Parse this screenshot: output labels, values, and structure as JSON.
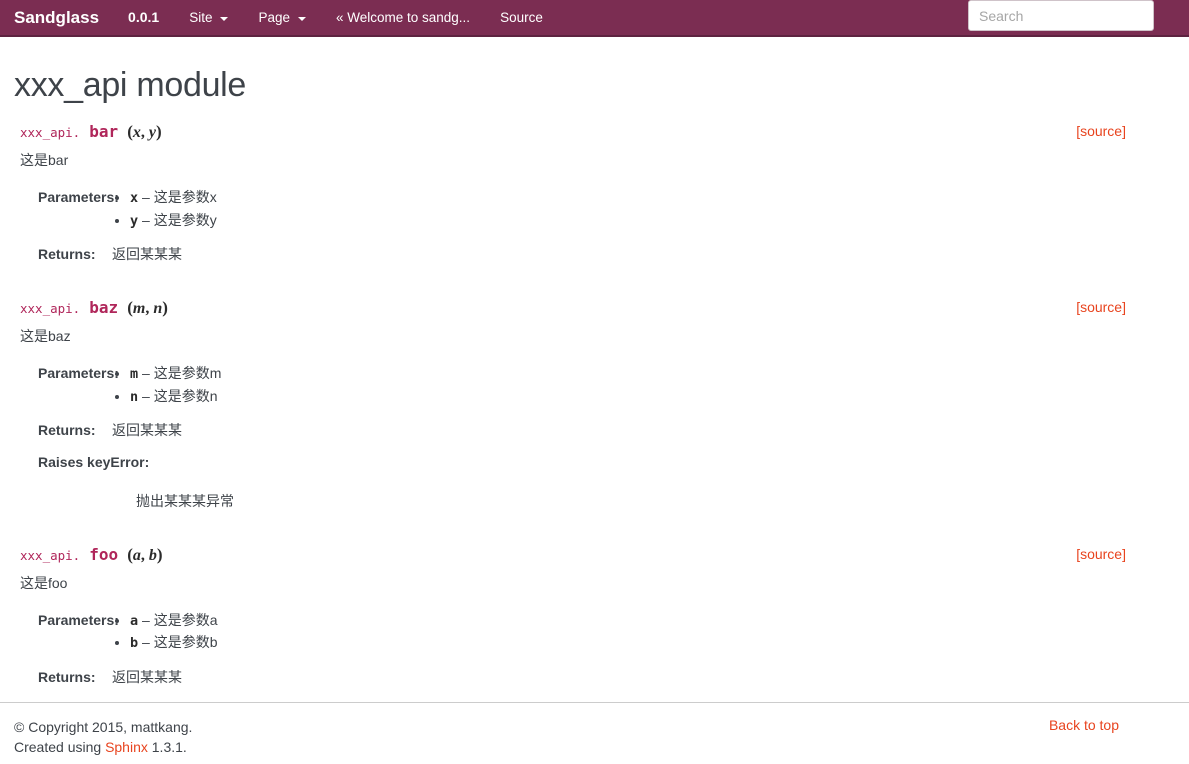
{
  "navbar": {
    "brand": "Sandglass",
    "items": [
      {
        "label": "0.0.1",
        "kind": "version",
        "caret": false
      },
      {
        "label": "Site",
        "kind": "dropdown",
        "caret": true
      },
      {
        "label": "Page",
        "kind": "dropdown",
        "caret": true
      },
      {
        "label": "« Welcome to sandg...",
        "kind": "link",
        "caret": false
      },
      {
        "label": "Source",
        "kind": "link",
        "caret": false
      }
    ],
    "search": {
      "placeholder": "Search",
      "value": ""
    },
    "colors": {
      "background": "#7b2d52",
      "border_bottom": "#5d2340",
      "text": "#ffffff"
    }
  },
  "page": {
    "title": "xxx_api module",
    "source_label": "[source]",
    "module_prefix": "xxx_api.",
    "link_color": "#e8441f",
    "signature_color": "#b0265a"
  },
  "functions": [
    {
      "prefix": "xxx_api.",
      "name": "bar",
      "params": [
        "x",
        "y"
      ],
      "description": "这是bar",
      "source_label": "[source]",
      "fields": [
        {
          "label": "Parameters:",
          "type": "list",
          "items": [
            {
              "name": "x",
              "dash": "–",
              "text": "这是参数x"
            },
            {
              "name": "y",
              "dash": "–",
              "text": "这是参数y"
            }
          ]
        },
        {
          "label": "Returns:",
          "type": "text",
          "value": "返回某某某"
        }
      ]
    },
    {
      "prefix": "xxx_api.",
      "name": "baz",
      "params": [
        "m",
        "n"
      ],
      "description": "这是baz",
      "source_label": "[source]",
      "fields": [
        {
          "label": "Parameters:",
          "type": "list",
          "items": [
            {
              "name": "m",
              "dash": "–",
              "text": "这是参数m"
            },
            {
              "name": "n",
              "dash": "–",
              "text": "这是参数n"
            }
          ]
        },
        {
          "label": "Returns:",
          "type": "text",
          "value": "返回某某某"
        },
        {
          "label": "Raises keyError:",
          "type": "block",
          "value": "抛出某某某异常"
        }
      ]
    },
    {
      "prefix": "xxx_api.",
      "name": "foo",
      "params": [
        "a",
        "b"
      ],
      "description": "这是foo",
      "source_label": "[source]",
      "fields": [
        {
          "label": "Parameters:",
          "type": "list",
          "items": [
            {
              "name": "a",
              "dash": "–",
              "text": "这是参数a"
            },
            {
              "name": "b",
              "dash": "–",
              "text": "这是参数b"
            }
          ]
        },
        {
          "label": "Returns:",
          "type": "text",
          "value": "返回某某某"
        }
      ]
    }
  ],
  "footer": {
    "copyright_line": "© Copyright 2015, mattkang.",
    "created_prefix": "Created using ",
    "sphinx_label": "Sphinx",
    "created_suffix": " 1.3.1.",
    "back_to_top": "Back to top"
  }
}
